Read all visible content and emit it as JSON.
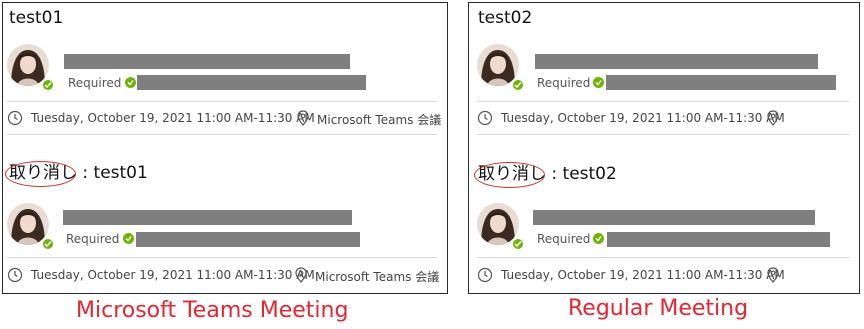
{
  "left_panel": {
    "caption": "Microsoft Teams Meeting",
    "cards": [
      {
        "title": "test01",
        "title_prefix": "",
        "attendee_status": "Required",
        "datetime": "Tuesday, October 19, 2021 11:00 AM-11:30 AM",
        "location": "Microsoft Teams 会議"
      },
      {
        "title": ": test01",
        "title_prefix": "取り消し",
        "attendee_status": "Required",
        "datetime": "Tuesday, October 19, 2021 11:00 AM-11:30 AM",
        "location": "Microsoft Teams 会議"
      }
    ]
  },
  "right_panel": {
    "caption": "Regular Meeting",
    "cards": [
      {
        "title": "test02",
        "title_prefix": "",
        "attendee_status": "Required",
        "datetime": "Tuesday, October 19, 2021 11:00 AM-11:30 AM",
        "location": ""
      },
      {
        "title": ": test02",
        "title_prefix": "取り消し",
        "attendee_status": "Required",
        "datetime": "Tuesday, October 19, 2021 11:00 AM-11:30 AM",
        "location": ""
      }
    ]
  },
  "icons": {
    "clock": "clock-icon",
    "location": "location-pin-icon",
    "presence": "available-check-icon"
  },
  "colors": {
    "highlight_circle": "#d0312d",
    "caption": "#e8242e",
    "presence": "#6bb700",
    "redaction": "#7f7f7f"
  }
}
